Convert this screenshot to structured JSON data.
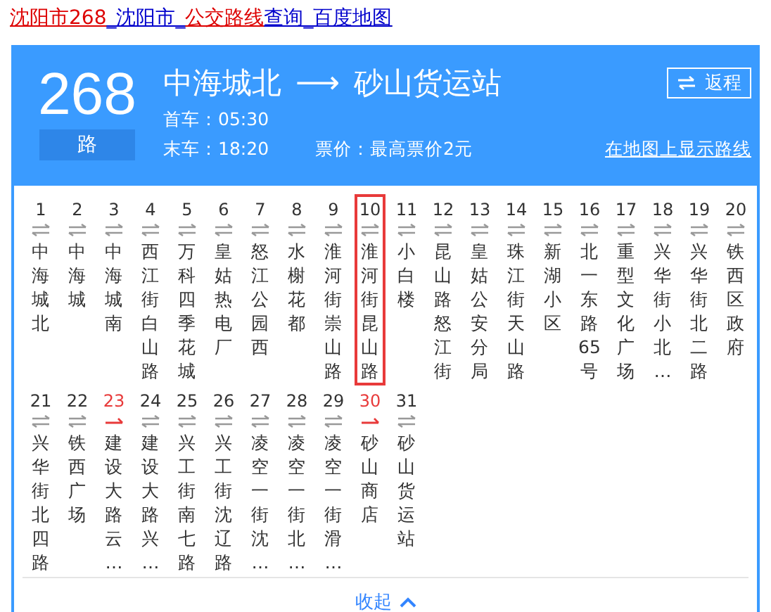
{
  "page_title": [
    {
      "text": "沈阳市268",
      "highlight": true
    },
    {
      "text": "_沈阳市_",
      "highlight": false
    },
    {
      "text": "公交路线",
      "highlight": true
    },
    {
      "text": "查询_百度地图",
      "highlight": false
    }
  ],
  "line": {
    "number": "268",
    "suffix": "路",
    "origin": "中海城北",
    "arrow": "⟶",
    "destination": "砂山货运站",
    "return_button": "返程",
    "first_bus": "首车：05:30",
    "last_bus": "末车：18:20",
    "fare": "票价：最高票价2元",
    "map_link": "在地图上显示路线"
  },
  "stations": [
    {
      "number": "1",
      "name": "中海城北",
      "kind": "both",
      "selected": false
    },
    {
      "number": "2",
      "name": "中海城",
      "kind": "both",
      "selected": false
    },
    {
      "number": "3",
      "name": "中海城南",
      "kind": "both",
      "selected": false
    },
    {
      "number": "4",
      "name": "西江街白山路",
      "kind": "both",
      "selected": false
    },
    {
      "number": "5",
      "name": "万科四季花城",
      "kind": "both",
      "selected": false
    },
    {
      "number": "6",
      "name": "皇姑热电厂",
      "kind": "both",
      "selected": false
    },
    {
      "number": "7",
      "name": "怒江公园西",
      "kind": "both",
      "selected": false
    },
    {
      "number": "8",
      "name": "水榭花都",
      "kind": "both",
      "selected": false
    },
    {
      "number": "9",
      "name": "淮河街崇山路",
      "kind": "both",
      "selected": false
    },
    {
      "number": "10",
      "name": "淮河街昆山路",
      "kind": "both",
      "selected": true
    },
    {
      "number": "11",
      "name": "小白楼",
      "kind": "both",
      "selected": false
    },
    {
      "number": "12",
      "name": "昆山路怒江街",
      "kind": "both",
      "selected": false
    },
    {
      "number": "13",
      "name": "皇姑公安分局",
      "kind": "both",
      "selected": false
    },
    {
      "number": "14",
      "name": "珠江街天山路",
      "kind": "both",
      "selected": false
    },
    {
      "number": "15",
      "name": "新湖小区",
      "kind": "both",
      "selected": false
    },
    {
      "number": "16",
      "name": "北一东路65号",
      "kind": "both",
      "selected": false
    },
    {
      "number": "17",
      "name": "重型文化广场",
      "kind": "both",
      "selected": false
    },
    {
      "number": "18",
      "name": "兴华街小北…",
      "kind": "both",
      "selected": false
    },
    {
      "number": "19",
      "name": "兴华街北二路",
      "kind": "both",
      "selected": false
    },
    {
      "number": "20",
      "name": "铁西区政府",
      "kind": "both",
      "selected": false
    },
    {
      "number": "21",
      "name": "兴华街北四路",
      "kind": "both",
      "selected": false
    },
    {
      "number": "22",
      "name": "铁西广场",
      "kind": "both",
      "selected": false
    },
    {
      "number": "23",
      "name": "建设大路云…",
      "kind": "one-way",
      "selected": false
    },
    {
      "number": "24",
      "name": "建设大路兴…",
      "kind": "both",
      "selected": false
    },
    {
      "number": "25",
      "name": "兴工街南七路",
      "kind": "both",
      "selected": false
    },
    {
      "number": "26",
      "name": "兴工街沈辽路",
      "kind": "both",
      "selected": false
    },
    {
      "number": "27",
      "name": "凌空一街沈…",
      "kind": "both",
      "selected": false
    },
    {
      "number": "28",
      "name": "凌空一街北…",
      "kind": "both",
      "selected": false
    },
    {
      "number": "29",
      "name": "凌空一街滑…",
      "kind": "both",
      "selected": false
    },
    {
      "number": "30",
      "name": "砂山商店",
      "kind": "one-way",
      "selected": false
    },
    {
      "number": "31",
      "name": "砂山货运站",
      "kind": "both",
      "selected": false
    }
  ],
  "collapse_link": "收起"
}
